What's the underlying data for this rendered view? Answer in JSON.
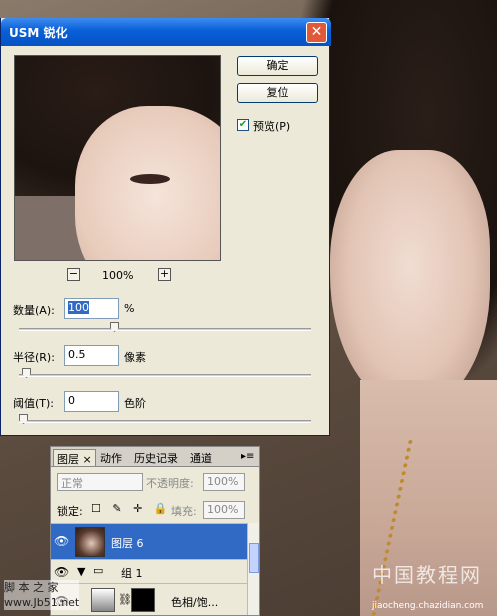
{
  "dialog": {
    "title": "USM 锐化",
    "close_label": "✕",
    "ok_label": "确定",
    "reset_label": "复位",
    "preview_label": "预览(P)",
    "preview_checked": true,
    "zoom_out": "−",
    "zoom_in": "+",
    "zoom_value": "100%",
    "amount_label": "数量(A):",
    "amount_value": "100",
    "amount_unit": "%",
    "amount_fraction": 0.32,
    "radius_label": "半径(R):",
    "radius_value": "0.5",
    "radius_unit": "像素",
    "radius_fraction": 0.01,
    "threshold_label": "阈值(T):",
    "threshold_value": "0",
    "threshold_unit": "色阶",
    "threshold_fraction": 0.0
  },
  "layers_panel": {
    "tabs": [
      "图层",
      "动作",
      "历史记录",
      "通道"
    ],
    "tab_close": "×",
    "menu_glyph": "▸≡",
    "blend_mode": "正常",
    "opacity_label": "不透明度:",
    "opacity_value": "100%",
    "lock_label": "锁定:",
    "lock_icons": "☐ ✎ ✛ 🔒",
    "fill_label": "填充:",
    "fill_value": "100%",
    "layers": [
      {
        "name": "图层 6",
        "selected": true
      },
      {
        "name": "组 1",
        "selected": false
      },
      {
        "name": "色相/饱...",
        "selected": false
      }
    ]
  },
  "watermarks": {
    "site_cn": "中国教程网",
    "site_url": "jiaocheng.chazidian.com",
    "left_line1": "脚 本 之 家",
    "left_line2": "www.Jb51.net"
  }
}
